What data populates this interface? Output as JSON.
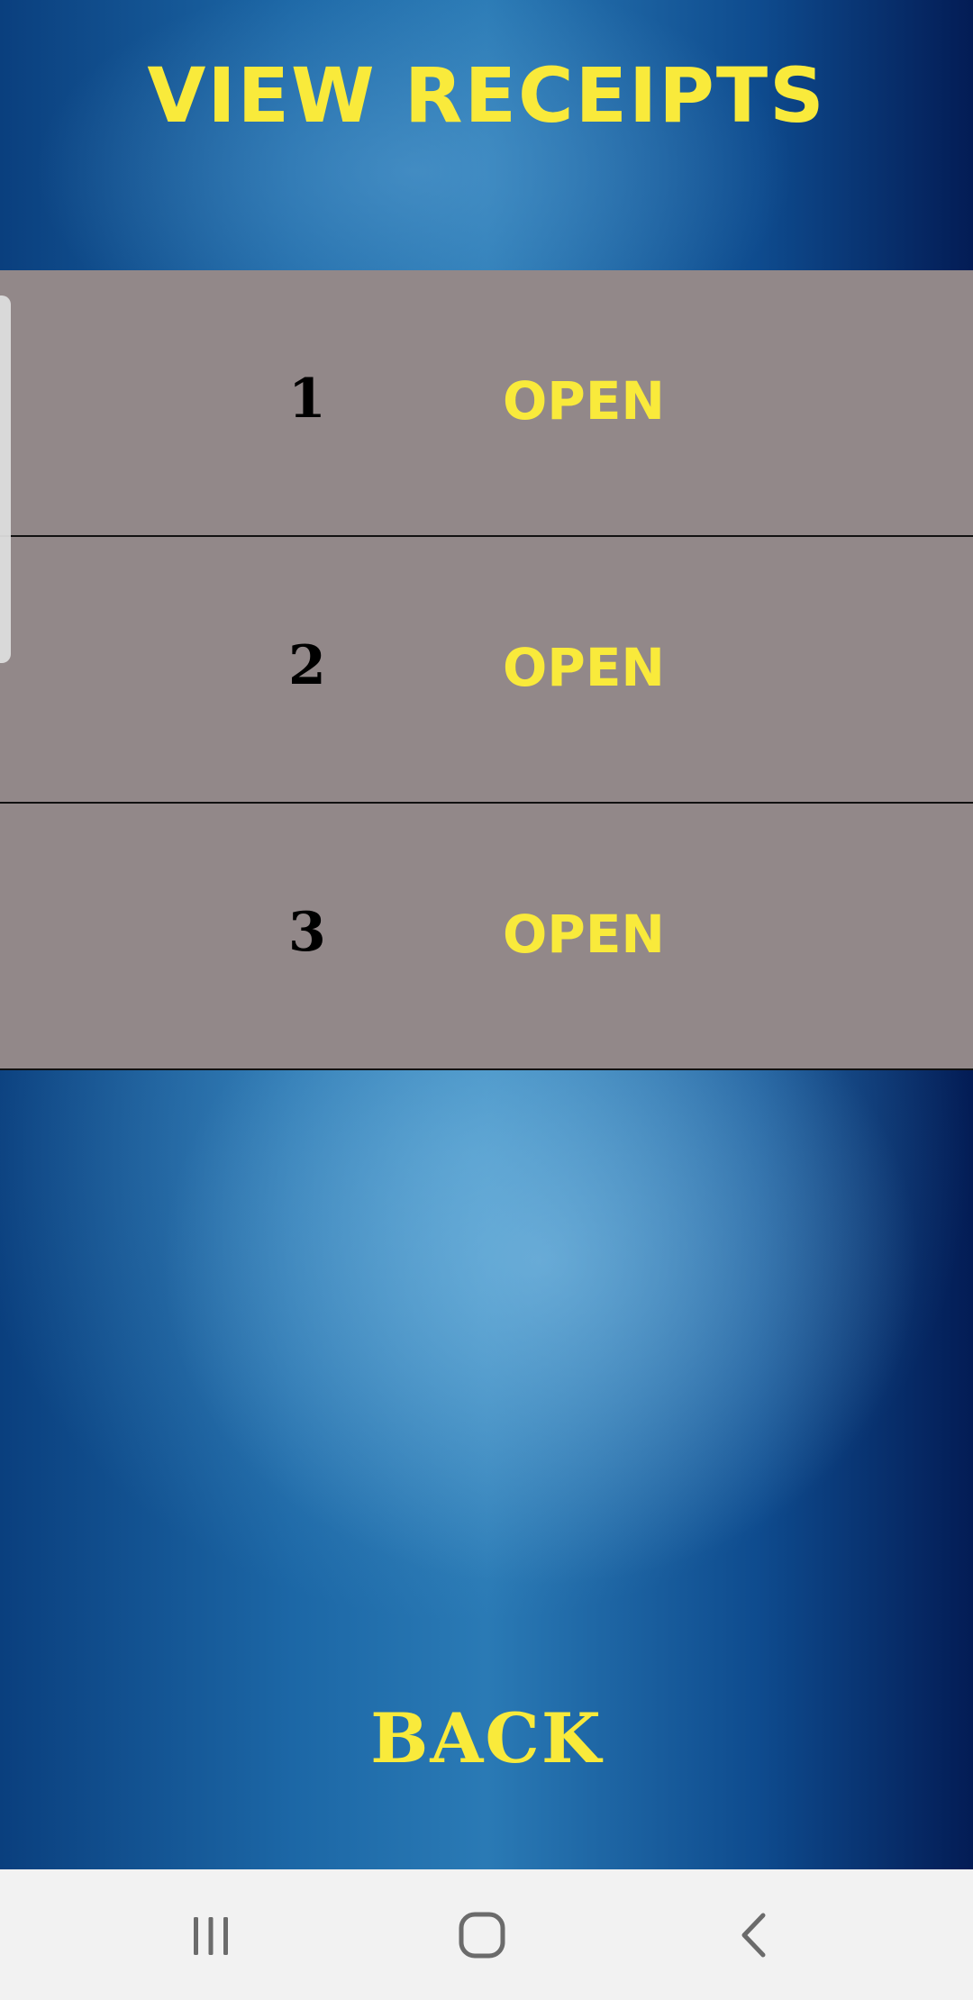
{
  "header": {
    "title": "VIEW RECEIPTS"
  },
  "receipts": [
    {
      "number": "1",
      "action_label": "OPEN"
    },
    {
      "number": "2",
      "action_label": "OPEN"
    },
    {
      "number": "3",
      "action_label": "OPEN"
    }
  ],
  "footer": {
    "back_label": "BACK"
  },
  "navigation_bar": {
    "buttons": [
      {
        "icon": "recent-apps-icon"
      },
      {
        "icon": "home-icon"
      },
      {
        "icon": "back-icon"
      }
    ]
  },
  "colors": {
    "accent_yellow": "#f9ea3b",
    "row_gray": "#928889",
    "nav_bar_bg": "#f2f2f2",
    "background_blue": "#1c67a6"
  }
}
